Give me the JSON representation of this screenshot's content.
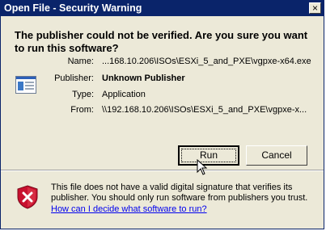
{
  "window": {
    "title": "Open File - Security Warning",
    "close_glyph": "×"
  },
  "heading": "The publisher could not be verified.  Are you sure you want to run this software?",
  "fields": [
    {
      "label": "Name:",
      "value": "...168.10.206\\ISOs\\ESXi_5_and_PXE\\vgpxe-x64.exe"
    },
    {
      "label": "Publisher:",
      "value": "Unknown Publisher"
    },
    {
      "label": "Type:",
      "value": "Application"
    },
    {
      "label": "From:",
      "value": "\\\\192.168.10.206\\ISOs\\ESXi_5_and_PXE\\vgpxe-x..."
    }
  ],
  "buttons": {
    "run": "Run",
    "cancel": "Cancel"
  },
  "warning": {
    "text": "This file does not have a valid digital signature that verifies its publisher.  You should only run software from publishers you trust.",
    "link": "How can I decide what software to run?"
  },
  "icons": {
    "app": "application-icon",
    "shield": "security-shield-icon",
    "cursor": "mouse-cursor-icon"
  },
  "colors": {
    "titlebar": "#0a246a",
    "dialog": "#ece9d8",
    "link": "#0000ee",
    "shield": "#c8102e"
  }
}
